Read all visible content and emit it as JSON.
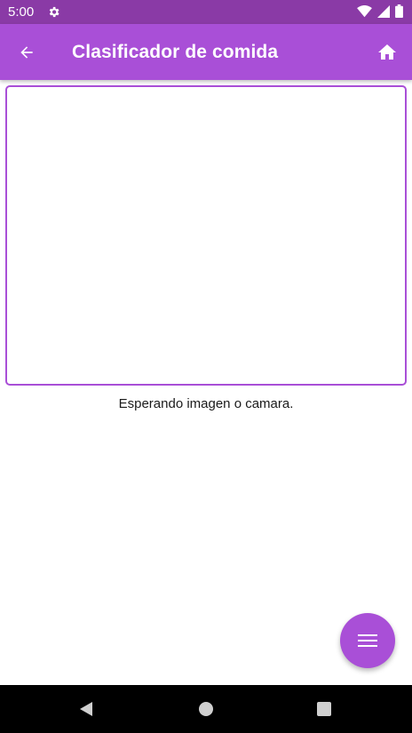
{
  "status_bar": {
    "time": "5:00",
    "icons": [
      "gear-icon",
      "wifi-icon",
      "signal-icon",
      "battery-icon"
    ],
    "background": "#8a3aa6"
  },
  "app_bar": {
    "title": "Clasificador de comida",
    "back_icon": "arrow-left-icon",
    "home_icon": "home-icon",
    "background": "#a94fd7"
  },
  "main": {
    "status_message": "Esperando imagen o camara.",
    "frame_border_color": "#a94fd7"
  },
  "fab": {
    "icon": "menu-icon",
    "background": "#a94fd7"
  },
  "nav_bar": {
    "icons": [
      "nav-back-icon",
      "nav-home-icon",
      "nav-recents-icon"
    ],
    "background": "#000000"
  }
}
